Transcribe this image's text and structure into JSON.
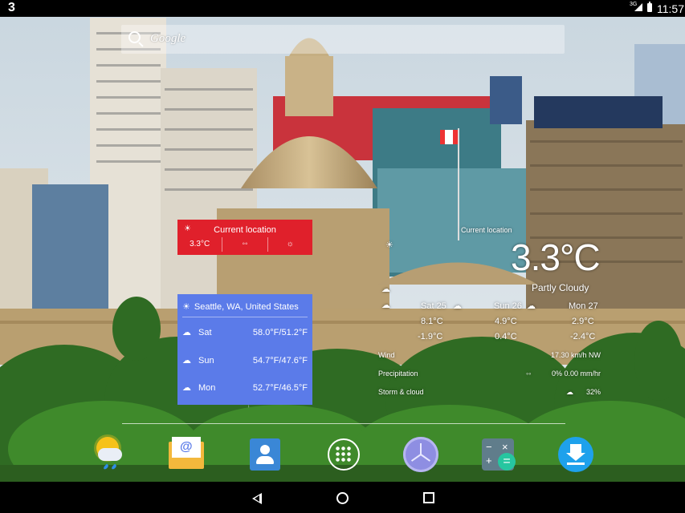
{
  "statusbar": {
    "notification_count": "3",
    "network": "3G",
    "time": "11:57"
  },
  "search": {
    "label": "Google"
  },
  "widget_red": {
    "title": "Current location",
    "cells": [
      "3.3°C",
      "",
      ""
    ]
  },
  "widget_blue": {
    "location": "Seattle, WA, United States",
    "days": [
      {
        "day": "Sat",
        "temp": "58.0°F/51.2°F"
      },
      {
        "day": "Sun",
        "temp": "54.7°F/47.6°F"
      },
      {
        "day": "Mon",
        "temp": "52.7°F/46.5°F"
      }
    ]
  },
  "widget_big": {
    "location": "Current location",
    "temperature": "3.3°C",
    "condition": "Partly Cloudy",
    "forecast": [
      {
        "day": "Sat 25",
        "high": "8.1°C",
        "low": "-1.9°C"
      },
      {
        "day": "Sun 26",
        "high": "4.9°C",
        "low": "0.4°C"
      },
      {
        "day": "Mon 27",
        "high": "2.9°C",
        "low": "-2.4°C"
      }
    ],
    "details": [
      {
        "label": "Wind",
        "value": "17.30 km/h  NW"
      },
      {
        "label": "Precipitation",
        "value": "0%  0.00 mm/hr"
      },
      {
        "label": "Storm & cloud",
        "value": "32%"
      }
    ]
  },
  "dock": [
    "weather-app",
    "email-app",
    "contacts-app",
    "app-drawer",
    "clock-app",
    "calculator-app",
    "downloads-app"
  ],
  "icons": {
    "weather": "weather-icon",
    "search": "search-icon"
  }
}
